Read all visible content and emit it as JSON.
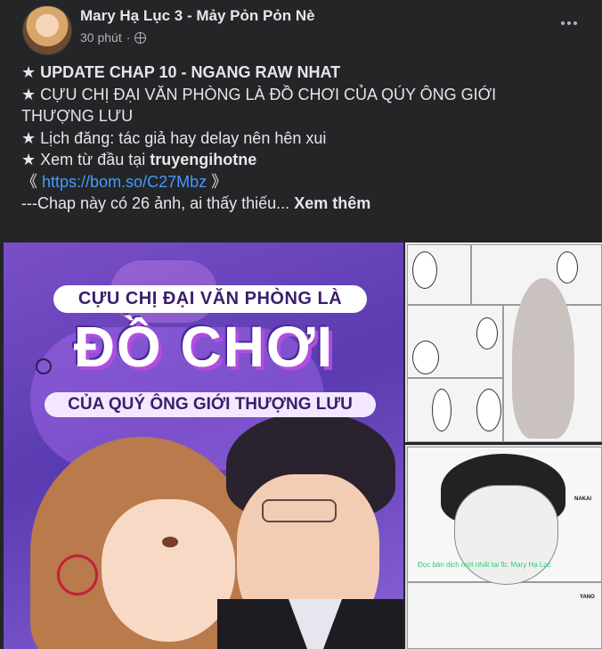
{
  "post": {
    "author": "Mary Hạ Lục 3 - Mảy Pỏn Pỏn Nè",
    "time": "30 phút",
    "separator": "·",
    "privacy_icon": "globe-icon",
    "more_icon": "more-dots-icon"
  },
  "body": {
    "line1": "★ UPDATE CHAP 10 - NGANG RAW NHAT",
    "line2": "★ CỰU CHỊ ĐẠI VĂN PHÒNG LÀ ĐỒ CHƠI CỦA QÚY ÔNG GIỚI",
    "line3": "THƯỢNG LƯU",
    "line4": "★ Lịch đăng: tác giả hay delay nên hên xui",
    "line5_prefix": "★ Xem từ đầu tại ",
    "line5_site": "truyengihotne",
    "line6_open": " 《 ",
    "link": "https://bom.so/C27Mbz",
    "line6_close": " 》",
    "line7": "---Chap này có 26 ảnh, ai thấy thiếu...",
    "see_more": "Xem thêm"
  },
  "media": {
    "cover_title_top": "CỰU CHỊ ĐẠI VĂN PHÒNG LÀ",
    "cover_title_main": "ĐỒ CHƠI",
    "cover_title_bottom": "CỦA QUÝ ÔNG GIỚI THƯỢNG LƯU",
    "manga_caption": "Đọc bản dịch mới nhất tại fb: Mary Hạ Lục",
    "manga_label_1": "NAKAI",
    "manga_label_2": "YANO"
  },
  "colors": {
    "background": "#242526",
    "text": "#e4e6eb",
    "secondary": "#b0b3b8",
    "link": "#4599ff"
  }
}
